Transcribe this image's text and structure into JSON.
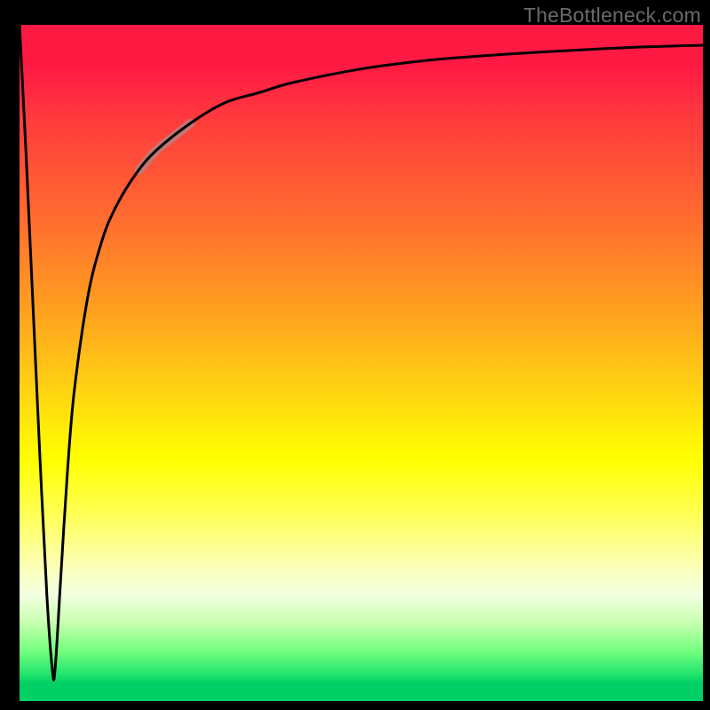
{
  "watermark": "TheBottleneck.com",
  "colors": {
    "top": "#ff1a44",
    "mid": "#ffff00",
    "bottom": "#00d065",
    "curve": "#000000",
    "highlight": "#b97f80",
    "page_bg": "#000000",
    "watermark": "#6a6a6a"
  },
  "chart_data": {
    "type": "line",
    "title": "",
    "xlabel": "",
    "ylabel": "",
    "xlim": [
      0,
      100
    ],
    "ylim": [
      0,
      100
    ],
    "grid": false,
    "legend": false,
    "note": "Axes are unlabeled; values are read as percentages of plot width/height. y=0 at bottom (green), y=100 at top (red). Curve drops to a narrow minimum near x≈5 then rises asymptotically toward ~97.",
    "series": [
      {
        "name": "curve",
        "x": [
          0.0,
          1.0,
          2.0,
          3.0,
          4.0,
          4.8,
          5.2,
          6.0,
          7.0,
          8.0,
          10.0,
          12.0,
          14.0,
          17.0,
          20.0,
          25.0,
          30.0,
          35.0,
          40.0,
          50.0,
          60.0,
          70.0,
          80.0,
          90.0,
          100.0
        ],
        "y": [
          100.0,
          80.0,
          58.0,
          36.0,
          16.0,
          5.0,
          5.0,
          18.0,
          34.0,
          46.0,
          60.0,
          68.0,
          73.0,
          78.0,
          81.5,
          85.5,
          88.5,
          90.0,
          91.5,
          93.5,
          94.8,
          95.6,
          96.2,
          96.7,
          97.0
        ]
      }
    ],
    "highlight_range_x": [
      17.5,
      25.0
    ]
  }
}
